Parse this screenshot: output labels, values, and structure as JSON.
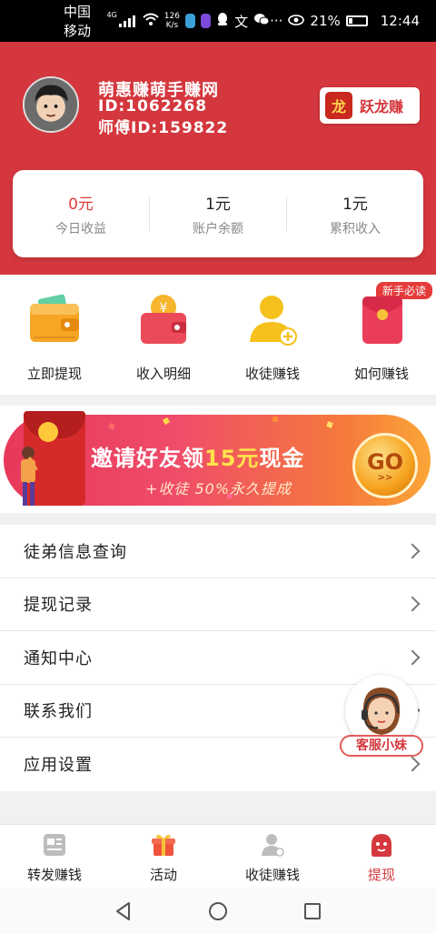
{
  "status_bar": {
    "carrier": "中国移动",
    "net": "4G",
    "speed_top": "126",
    "speed_bottom": "K/s",
    "battery": "21%",
    "time": "12:44"
  },
  "profile": {
    "name": "萌惠赚萌手赚网",
    "id": "ID:1062268",
    "master_id": "师傅ID:159822"
  },
  "brand_button": {
    "label": "跃龙赚"
  },
  "stats": [
    {
      "value": "0元",
      "label": "今日收益",
      "highlight": true
    },
    {
      "value": "1元",
      "label": "账户余额",
      "highlight": false
    },
    {
      "value": "1元",
      "label": "累积收入",
      "highlight": false
    }
  ],
  "actions": [
    {
      "label": "立即提现",
      "icon": "wallet-icon"
    },
    {
      "label": "收入明细",
      "icon": "coin-purse-icon"
    },
    {
      "label": "收徒赚钱",
      "icon": "add-user-icon"
    },
    {
      "label": "如何赚钱",
      "icon": "red-envelope-icon",
      "badge": "新手必读"
    }
  ],
  "banner": {
    "title_pre": "邀请好友领",
    "title_hl": "15元",
    "title_post": "现金",
    "subtitle": "+收徒 50%永久提成",
    "go": "GO",
    "go_sub": ">>"
  },
  "menu": [
    {
      "label": "徒弟信息查询"
    },
    {
      "label": "提现记录"
    },
    {
      "label": "通知中心"
    },
    {
      "label": "联系我们"
    },
    {
      "label": "应用设置"
    }
  ],
  "customer_service": {
    "label": "客服小妹"
  },
  "tabs": [
    {
      "label": "转发赚钱",
      "icon": "share-doc-icon",
      "active": false
    },
    {
      "label": "活动",
      "icon": "gift-icon",
      "active": false
    },
    {
      "label": "收徒赚钱",
      "icon": "user-icon",
      "active": false
    },
    {
      "label": "提现",
      "icon": "withdraw-icon",
      "active": true
    }
  ],
  "colors": {
    "brand_red": "#d4373d",
    "accent_gold": "#f6a21e",
    "highlight_yellow": "#ffe24a"
  }
}
